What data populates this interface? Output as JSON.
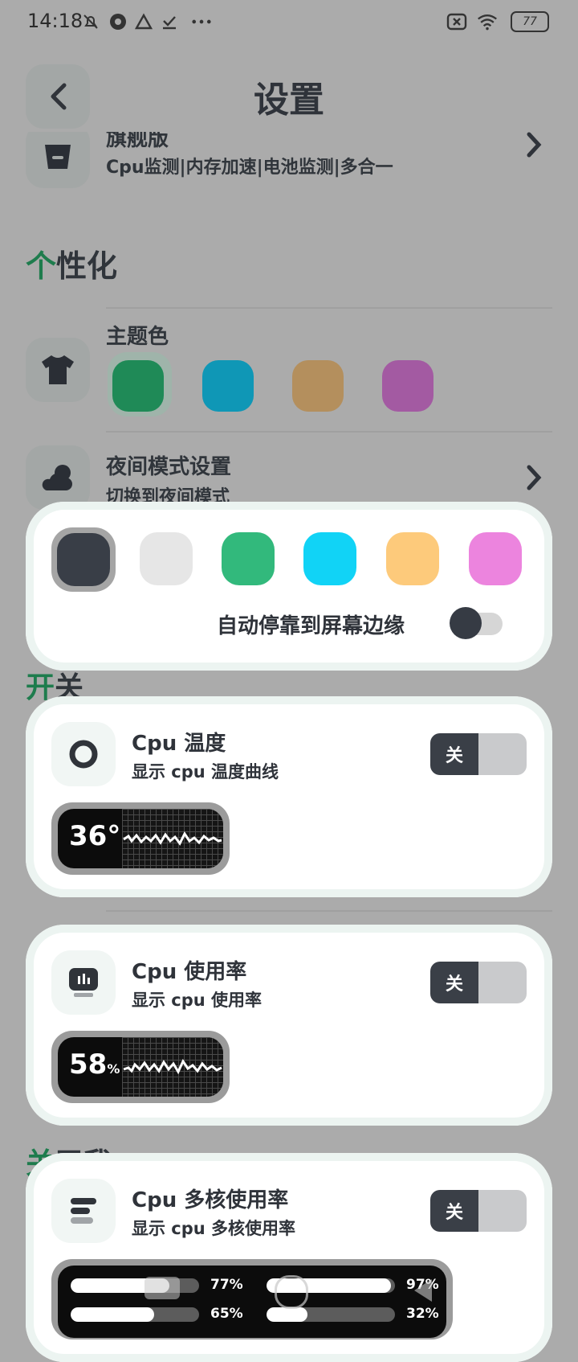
{
  "status_bar": {
    "time": "14:18",
    "battery": "77"
  },
  "header": {
    "title": "设置"
  },
  "premium_row": {
    "title_partial": "旗舰版",
    "subtitle": "Cpu监测|内存加速|电池监测|多合一"
  },
  "personalize": {
    "section_accent": "个",
    "section_rest": "性化",
    "theme_label": "主题色",
    "theme_colors": [
      "#1f8a57",
      "#0f97b6",
      "#b48f5d",
      "#a35aa2"
    ],
    "night_title": "夜间模式设置",
    "night_sub": "切换到夜间模式"
  },
  "dock_panel": {
    "colors": [
      "#393e47",
      "#e6e6e6",
      "#32b97c",
      "#11d3f6",
      "#fdca7b",
      "#ec84de"
    ],
    "auto_dock_label": "自动停靠到屏幕边缘",
    "auto_dock_enabled": false
  },
  "switch_section": {
    "accent": "开",
    "rest": "关"
  },
  "about_section": {
    "accent": "关",
    "rest": "于我"
  },
  "cards": [
    {
      "title": "Cpu 温度",
      "subtitle": "显示 cpu 温度曲线",
      "switch_label": "关",
      "widget_value": "36°",
      "widget_unit": ""
    },
    {
      "title": "Cpu 使用率",
      "subtitle": "显示 cpu 使用率",
      "switch_label": "关",
      "widget_value": "58",
      "widget_unit": "%"
    },
    {
      "title": "Cpu 多核使用率",
      "subtitle": "显示 cpu 多核使用率",
      "switch_label": "关"
    }
  ],
  "multicore": [
    {
      "label": "77%",
      "value": 0.77
    },
    {
      "label": "97%",
      "value": 0.97
    },
    {
      "label": "65%",
      "value": 0.65
    },
    {
      "label": "32%",
      "value": 0.32
    }
  ]
}
